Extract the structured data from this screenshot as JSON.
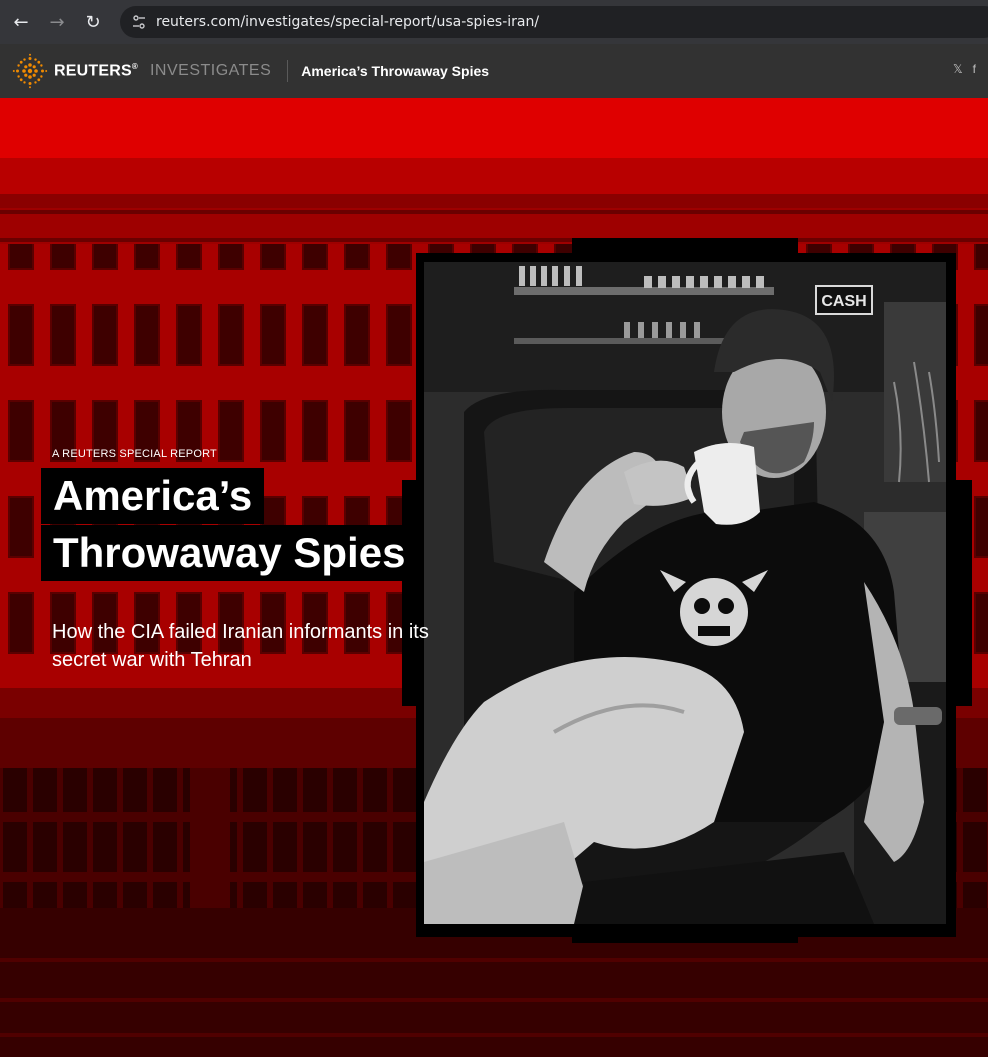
{
  "browser": {
    "back_icon": "←",
    "forward_icon": "→",
    "reload_icon": "↻",
    "url": "reuters.com/investigates/special-report/usa-spies-iran/"
  },
  "header": {
    "brand": "REUTERS",
    "brand_mark": "®",
    "section": "INVESTIGATES",
    "story_title": "America’s Throwaway Spies",
    "social": {
      "twitter": "𝕏",
      "facebook": "f"
    }
  },
  "hero": {
    "kicker": "A REUTERS SPECIAL REPORT",
    "headline_line1": "America’s",
    "headline_line2": "Throwaway Spies",
    "dek": "How the CIA failed Iranian informants in its secret war with Tehran",
    "photo_sign": "CASH"
  },
  "colors": {
    "hero_red": "#d10000",
    "chrome_dark": "#35363a",
    "reuters_bar": "#323232",
    "brand_orange": "#f08a00"
  }
}
